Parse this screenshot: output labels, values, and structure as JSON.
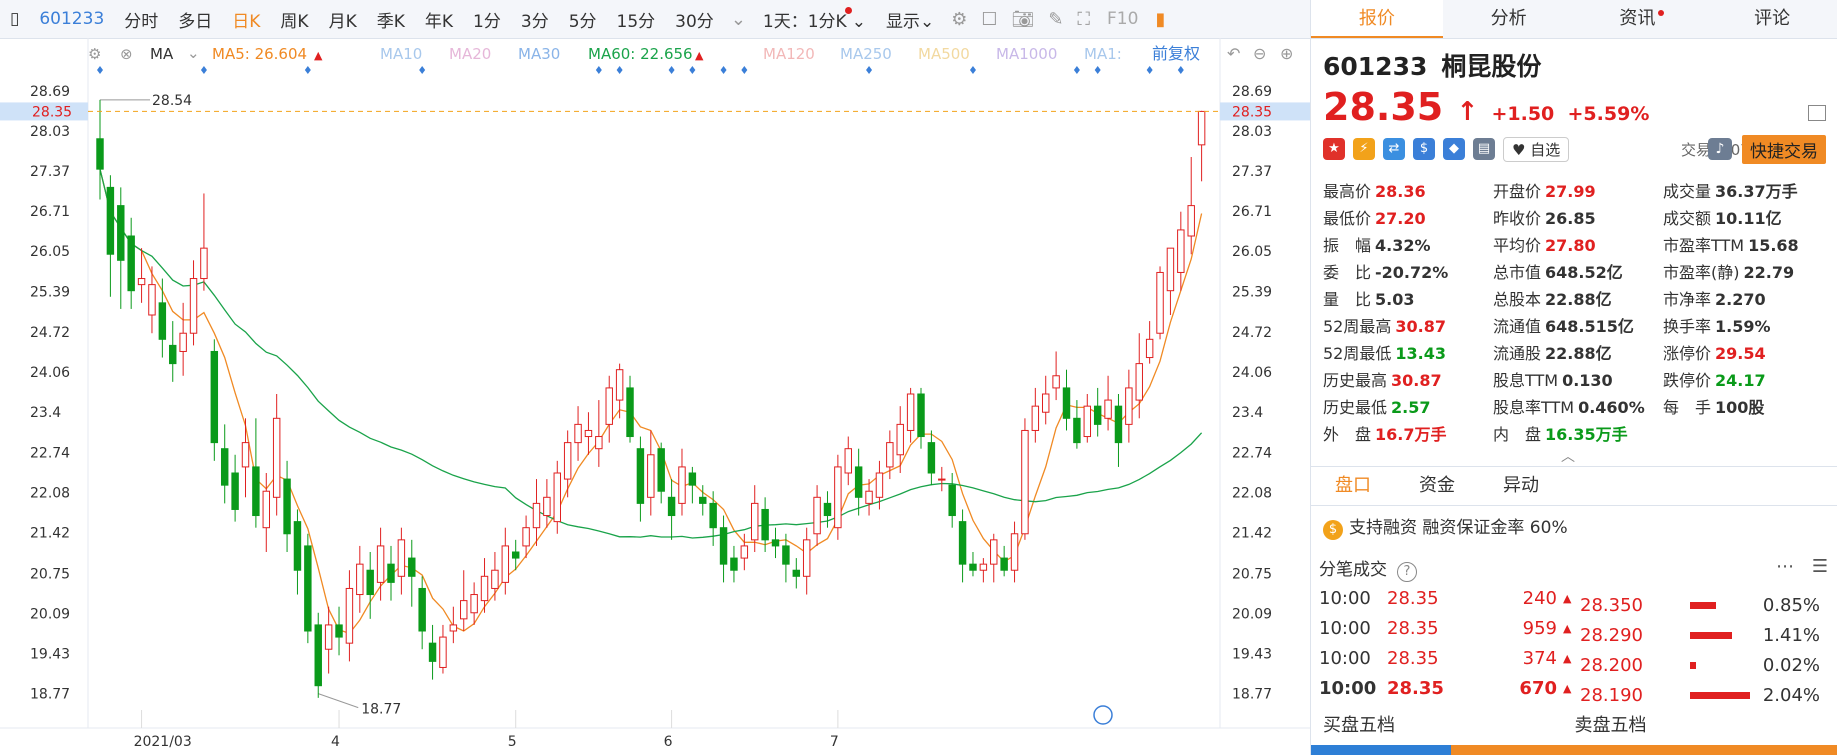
{
  "toolbar": {
    "code": "601233",
    "items": [
      "分时",
      "多日",
      "日K",
      "周K",
      "月K",
      "季K",
      "年K",
      "1分",
      "3分",
      "5分",
      "15分",
      "30分"
    ],
    "active": "日K",
    "interval": "1天：1分K",
    "display": "显示",
    "f10": "F10"
  },
  "indicators": {
    "ma_label": "MA",
    "ma5": "MA5: 26.604",
    "ma10": "MA10",
    "ma20": "MA20",
    "ma30": "MA30",
    "ma60": "MA60: 22.656",
    "ma120": "MA120",
    "ma250": "MA250",
    "ma500": "MA500",
    "ma1000": "MA1000",
    "ma1": "MA1:",
    "adjust": "前复权"
  },
  "chart_data": {
    "type": "candlestick",
    "y_ticks": [
      28.69,
      28.03,
      27.37,
      26.71,
      26.05,
      25.39,
      24.72,
      24.06,
      23.4,
      22.74,
      22.08,
      21.42,
      20.75,
      20.09,
      19.43,
      18.77
    ],
    "y_range": [
      18.5,
      28.9
    ],
    "current_price": 28.35,
    "high_annotation": "28.54",
    "low_annotation": "18.77",
    "x_labels": [
      {
        "label": "2021/03",
        "index": 4
      },
      {
        "label": "4",
        "index": 23
      },
      {
        "label": "5",
        "index": 40
      },
      {
        "label": "6",
        "index": 55
      },
      {
        "label": "7",
        "index": 71
      }
    ],
    "candles": [
      [
        27.9,
        27.4,
        28.54,
        26.9
      ],
      [
        27.1,
        26.0,
        27.3,
        25.3
      ],
      [
        26.8,
        25.9,
        27.1,
        25.1
      ],
      [
        26.3,
        25.4,
        26.6,
        25.1
      ],
      [
        25.5,
        25.6,
        26.1,
        25.2
      ],
      [
        25.0,
        25.5,
        25.8,
        24.7
      ],
      [
        25.2,
        24.6,
        25.6,
        24.3
      ],
      [
        24.5,
        24.2,
        24.9,
        23.9
      ],
      [
        24.4,
        24.7,
        25.2,
        24.0
      ],
      [
        24.7,
        25.6,
        25.9,
        24.5
      ],
      [
        25.6,
        26.1,
        27.0,
        25.4
      ],
      [
        24.4,
        22.9,
        24.6,
        22.6
      ],
      [
        22.8,
        22.2,
        23.2,
        21.9
      ],
      [
        22.4,
        21.8,
        22.7,
        21.6
      ],
      [
        22.5,
        22.9,
        23.3,
        22.0
      ],
      [
        22.5,
        21.7,
        23.3,
        21.5
      ],
      [
        21.5,
        22.1,
        22.4,
        21.1
      ],
      [
        22.0,
        23.3,
        23.7,
        21.7
      ],
      [
        22.3,
        21.4,
        22.6,
        21.1
      ],
      [
        21.6,
        20.8,
        21.8,
        20.4
      ],
      [
        21.2,
        19.8,
        21.4,
        19.6
      ],
      [
        19.9,
        18.9,
        20.1,
        18.7
      ],
      [
        19.5,
        19.9,
        20.2,
        19.1
      ],
      [
        19.9,
        19.7,
        20.2,
        19.4
      ],
      [
        19.6,
        20.5,
        20.8,
        19.3
      ],
      [
        20.4,
        20.9,
        21.2,
        20.1
      ],
      [
        20.8,
        20.4,
        21.1,
        20.0
      ],
      [
        20.6,
        21.2,
        21.5,
        20.3
      ],
      [
        20.9,
        20.6,
        21.2,
        20.3
      ],
      [
        20.7,
        21.3,
        21.5,
        20.4
      ],
      [
        21.0,
        20.7,
        21.3,
        20.2
      ],
      [
        20.5,
        19.8,
        20.7,
        19.5
      ],
      [
        19.6,
        19.3,
        19.9,
        19.0
      ],
      [
        19.2,
        19.7,
        19.9,
        19.1
      ],
      [
        19.8,
        19.9,
        20.2,
        19.6
      ],
      [
        20.0,
        20.3,
        20.8,
        19.8
      ],
      [
        20.1,
        20.4,
        20.6,
        19.9
      ],
      [
        20.3,
        20.7,
        21.0,
        20.1
      ],
      [
        20.5,
        20.8,
        21.1,
        20.3
      ],
      [
        20.6,
        21.2,
        21.5,
        20.4
      ],
      [
        21.1,
        21.0,
        21.3,
        20.8
      ],
      [
        21.2,
        21.5,
        21.7,
        21.0
      ],
      [
        21.5,
        21.9,
        22.3,
        21.2
      ],
      [
        21.7,
        22.0,
        22.3,
        21.5
      ],
      [
        21.6,
        22.4,
        22.6,
        21.4
      ],
      [
        22.3,
        22.9,
        23.1,
        22.0
      ],
      [
        22.9,
        23.2,
        23.5,
        22.6
      ],
      [
        23.0,
        23.1,
        23.4,
        22.7
      ],
      [
        22.8,
        23.0,
        23.6,
        22.5
      ],
      [
        23.2,
        23.8,
        24.0,
        22.9
      ],
      [
        23.6,
        24.1,
        24.2,
        23.3
      ],
      [
        23.8,
        23.0,
        24.0,
        22.9
      ],
      [
        22.8,
        21.9,
        23.0,
        21.6
      ],
      [
        22.0,
        22.7,
        23.1,
        21.7
      ],
      [
        22.8,
        22.1,
        22.9,
        21.9
      ],
      [
        22.0,
        21.7,
        22.3,
        21.3
      ],
      [
        21.9,
        22.5,
        22.8,
        21.7
      ],
      [
        22.4,
        22.2,
        22.5,
        21.9
      ],
      [
        22.0,
        21.9,
        22.2,
        21.7
      ],
      [
        21.9,
        21.5,
        22.1,
        21.2
      ],
      [
        21.5,
        20.9,
        21.7,
        20.6
      ],
      [
        21.0,
        20.8,
        21.2,
        20.6
      ],
      [
        21.0,
        21.2,
        21.4,
        20.8
      ],
      [
        21.3,
        21.9,
        22.2,
        21.1
      ],
      [
        21.8,
        21.3,
        22.0,
        21.1
      ],
      [
        21.3,
        21.2,
        21.5,
        21.0
      ],
      [
        21.2,
        20.9,
        21.4,
        20.6
      ],
      [
        20.8,
        20.7,
        21.0,
        20.5
      ],
      [
        20.7,
        21.3,
        21.5,
        20.4
      ],
      [
        21.4,
        22.0,
        22.2,
        21.2
      ],
      [
        21.9,
        21.7,
        22.1,
        21.5
      ],
      [
        21.5,
        22.5,
        22.7,
        21.3
      ],
      [
        22.4,
        22.8,
        23.0,
        22.2
      ],
      [
        22.5,
        22.0,
        22.8,
        21.7
      ],
      [
        21.9,
        22.1,
        22.3,
        21.7
      ],
      [
        22.0,
        22.4,
        22.6,
        21.8
      ],
      [
        22.5,
        22.9,
        23.1,
        22.3
      ],
      [
        22.7,
        23.2,
        23.5,
        22.4
      ],
      [
        23.1,
        23.7,
        23.8,
        22.9
      ],
      [
        23.7,
        23.0,
        23.8,
        22.8
      ],
      [
        22.9,
        22.4,
        23.1,
        22.2
      ],
      [
        22.3,
        22.3,
        22.5,
        22.1
      ],
      [
        22.2,
        21.7,
        22.4,
        21.5
      ],
      [
        21.6,
        20.9,
        21.8,
        20.6
      ],
      [
        20.9,
        20.8,
        21.1,
        20.7
      ],
      [
        20.8,
        20.9,
        21.0,
        20.6
      ],
      [
        20.9,
        21.3,
        21.4,
        20.6
      ],
      [
        21.0,
        20.8,
        21.2,
        20.7
      ],
      [
        20.8,
        21.4,
        21.6,
        20.6
      ],
      [
        21.4,
        23.1,
        23.3,
        21.3
      ],
      [
        23.1,
        23.5,
        23.8,
        22.9
      ],
      [
        23.4,
        23.7,
        24.0,
        23.2
      ],
      [
        23.8,
        24.0,
        24.4,
        23.6
      ],
      [
        23.8,
        23.3,
        24.1,
        23.1
      ],
      [
        23.3,
        22.9,
        23.6,
        22.8
      ],
      [
        23.0,
        23.5,
        23.7,
        22.9
      ],
      [
        23.5,
        23.2,
        23.8,
        23.0
      ],
      [
        23.3,
        23.6,
        24.0,
        23.1
      ],
      [
        23.5,
        22.9,
        23.7,
        22.5
      ],
      [
        23.2,
        23.8,
        24.1,
        22.9
      ],
      [
        23.6,
        24.2,
        24.7,
        23.3
      ],
      [
        24.3,
        24.6,
        24.9,
        24.2
      ],
      [
        24.7,
        25.7,
        25.8,
        24.6
      ],
      [
        25.4,
        26.1,
        26.1,
        25.0
      ],
      [
        25.7,
        26.4,
        26.7,
        25.4
      ],
      [
        26.3,
        26.8,
        27.6,
        26.0
      ],
      [
        27.8,
        28.35,
        28.36,
        27.2
      ]
    ]
  },
  "ma_colors": {
    "ma5": "#f08a24",
    "ma60": "#1aa34a",
    "up": "#e02020",
    "down": "#0a9a1a"
  },
  "quote": {
    "code": "601233",
    "name": "桐昆股份",
    "price": "28.35",
    "arrow": "↑",
    "change": "+1.50",
    "change_pct": "+5.59%",
    "state": "交易中 07/16 10:00",
    "watch": "自选",
    "trade": "快捷交易"
  },
  "panel_tabs": [
    "报价",
    "分析",
    "资讯",
    "评论"
  ],
  "fields": [
    [
      {
        "label": "最高价",
        "value": "28.36",
        "c": "red"
      },
      {
        "label": "开盘价",
        "value": "27.99",
        "c": "red"
      },
      {
        "label": "成交量",
        "value": "36.37万手",
        "c": "dark"
      }
    ],
    [
      {
        "label": "最低价",
        "value": "27.20",
        "c": "red"
      },
      {
        "label": "昨收价",
        "value": "26.85",
        "c": "dark"
      },
      {
        "label": "成交额",
        "value": "10.11亿",
        "c": "dark"
      }
    ],
    [
      {
        "label": "振　幅",
        "value": "4.32%",
        "c": "dark"
      },
      {
        "label": "平均价",
        "value": "27.80",
        "c": "red"
      },
      {
        "label": "市盈率TTM",
        "value": "15.68",
        "c": "dark"
      }
    ],
    [
      {
        "label": "委　比",
        "value": "-20.72%",
        "c": "dark"
      },
      {
        "label": "总市值",
        "value": "648.52亿",
        "c": "dark"
      },
      {
        "label": "市盈率(静)",
        "value": "22.79",
        "c": "dark"
      }
    ],
    [
      {
        "label": "量　比",
        "value": "5.03",
        "c": "dark"
      },
      {
        "label": "总股本",
        "value": "22.88亿",
        "c": "dark"
      },
      {
        "label": "市净率",
        "value": "2.270",
        "c": "dark"
      }
    ],
    [
      {
        "label": "52周最高",
        "value": "30.87",
        "c": "red"
      },
      {
        "label": "流通值",
        "value": "648.515亿",
        "c": "dark"
      },
      {
        "label": "换手率",
        "value": "1.59%",
        "c": "dark"
      }
    ],
    [
      {
        "label": "52周最低",
        "value": "13.43",
        "c": "green"
      },
      {
        "label": "流通股",
        "value": "22.88亿",
        "c": "dark"
      },
      {
        "label": "涨停价",
        "value": "29.54",
        "c": "red"
      }
    ],
    [
      {
        "label": "历史最高",
        "value": "30.87",
        "c": "red"
      },
      {
        "label": "股息TTM",
        "value": "0.130",
        "c": "dark"
      },
      {
        "label": "跌停价",
        "value": "24.17",
        "c": "green"
      }
    ],
    [
      {
        "label": "历史最低",
        "value": "2.57",
        "c": "green"
      },
      {
        "label": "股息率TTM",
        "value": "0.460%",
        "c": "dark"
      },
      {
        "label": "每　手",
        "value": "100股",
        "c": "dark"
      }
    ],
    [
      {
        "label": "外　盘",
        "value": "16.7万手",
        "c": "red"
      },
      {
        "label": "内　盘",
        "value": "16.35万手",
        "c": "green"
      },
      {
        "label": "",
        "value": "",
        "c": "dark"
      }
    ]
  ],
  "subtabs": [
    "盘口",
    "资金",
    "异动"
  ],
  "margin_text": "支持融资 融资保证金率 60%",
  "tick_title": "分笔成交",
  "ticks": [
    {
      "time": "10:00",
      "price": "28.35",
      "vol": "240"
    },
    {
      "time": "10:00",
      "price": "28.35",
      "vol": "959"
    },
    {
      "time": "10:00",
      "price": "28.35",
      "vol": "374"
    },
    {
      "time": "10:00",
      "price": "28.35",
      "vol": "670"
    }
  ],
  "levels": [
    {
      "price": "28.350",
      "pct": "0.85%"
    },
    {
      "price": "28.290",
      "pct": "1.41%"
    },
    {
      "price": "28.200",
      "pct": "0.02%"
    },
    {
      "price": "28.190",
      "pct": "2.04%"
    }
  ],
  "book": {
    "buy": "买盘五档",
    "sell": "卖盘五档"
  }
}
